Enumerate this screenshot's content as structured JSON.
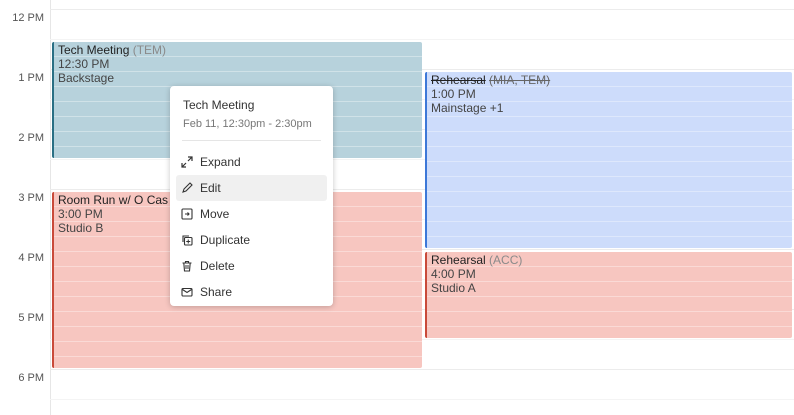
{
  "time_labels": [
    "12 PM",
    "1 PM",
    "2 PM",
    "3 PM",
    "4 PM",
    "5 PM",
    "6 PM"
  ],
  "events": {
    "tech": {
      "title": "Tech Meeting",
      "code": "(TEM)",
      "time": "12:30 PM",
      "location": "Backstage"
    },
    "roomrun": {
      "title": "Room Run w/ O Cas",
      "time": "3:00 PM",
      "location": "Studio B"
    },
    "rehearsal1": {
      "title": "Rehearsal",
      "code": "(MIA, TEM)",
      "time": "1:00 PM",
      "location": "Mainstage +1"
    },
    "rehearsal2": {
      "title": "Rehearsal",
      "code": "(ACC)",
      "time": "4:00 PM",
      "location": "Studio A"
    }
  },
  "popup": {
    "title": "Tech Meeting",
    "date": "Feb 11, 12:30pm - 2:30pm",
    "menu": [
      {
        "label": "Expand",
        "icon": "expand-icon"
      },
      {
        "label": "Edit",
        "icon": "pencil-icon"
      },
      {
        "label": "Move",
        "icon": "move-icon"
      },
      {
        "label": "Duplicate",
        "icon": "duplicate-icon"
      },
      {
        "label": "Delete",
        "icon": "trash-icon"
      },
      {
        "label": "Share",
        "icon": "share-icon"
      }
    ]
  },
  "colors": {
    "tech_bg": "#b7d2dc",
    "tech_border": "#2a6f84",
    "red_bg": "#f7c6c0",
    "red_border": "#c94a3a",
    "blue_bg": "#cddcfb",
    "blue_border": "#3d78d8"
  }
}
